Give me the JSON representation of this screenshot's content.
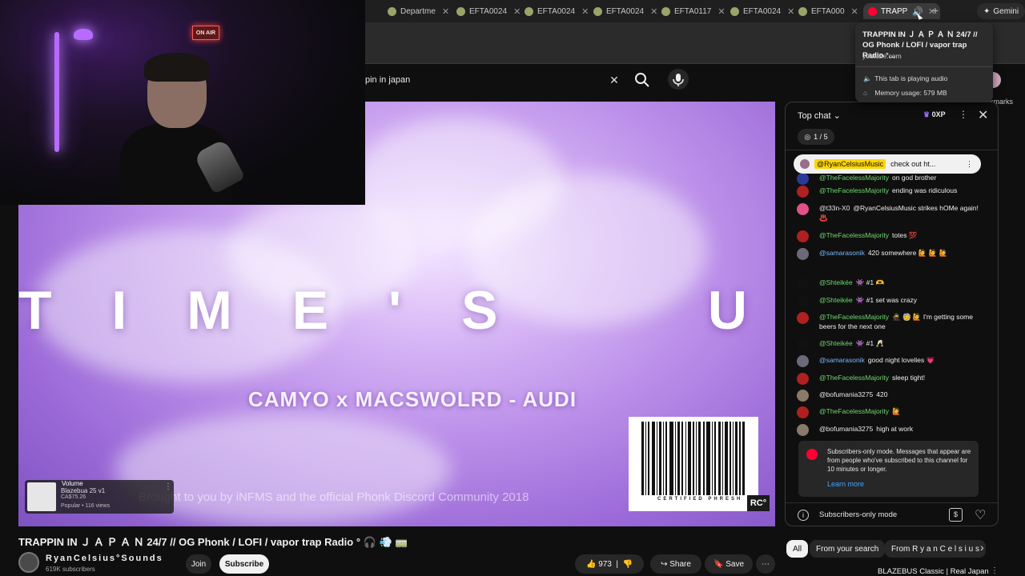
{
  "browser": {
    "tabs": [
      {
        "label": "Departme",
        "color": "#9aa36a"
      },
      {
        "label": "EFTA0024",
        "color": "#9aa36a"
      },
      {
        "label": "EFTA0024",
        "color": "#9aa36a"
      },
      {
        "label": "EFTA0024",
        "color": "#9aa36a"
      },
      {
        "label": "EFTA0117",
        "color": "#9aa36a"
      },
      {
        "label": "EFTA0024",
        "color": "#9aa36a"
      },
      {
        "label": "EFTA000",
        "color": "#9aa36a"
      },
      {
        "label": "TRAPP",
        "color": "#ff0033"
      }
    ],
    "new_tab": "+",
    "gemini_label": "Gemini",
    "addr_right": "able",
    "bookmarks_right": "kmarks"
  },
  "tooltip": {
    "title": "TRAPPIN IN Ｊ Ａ Ｐ Ａ Ｎ 24/7 // OG Phonk / LOFI / vapor trap Radio °...",
    "domain": "youtube.com",
    "audio": "This tab is playing audio",
    "memory": "Memory usage: 579 MB"
  },
  "search": {
    "query": "pin in japan"
  },
  "webcam": {
    "on_air": "ON AIR"
  },
  "video": {
    "headline": "T I M E ' S     U P",
    "song": "CAMYO x MACSWOLRD - AUDI",
    "credit": "Brought to you by iNFMS and the official Phonk Discord Community 2018",
    "barcode_label": "CERTIFIED PHRESH",
    "logo": "RC°",
    "mini_player": {
      "volume": "Volume",
      "title": "Blazebua 25 v1",
      "price": "CA$75.26",
      "meta": "Popular • 116 views"
    }
  },
  "below": {
    "title": "TRAPPIN IN Ｊ Ａ Ｐ Ａ Ｎ 24/7 // OG Phonk / LOFI / vapor trap Radio ° 🎧 💨 🚃",
    "channel": "RyanCelsius°Sounds",
    "subscribers": "619K subscribers",
    "join": "Join",
    "subscribe": "Subscribe",
    "likes": "973",
    "share": "Share",
    "save": "Save"
  },
  "chat": {
    "header": "Top chat",
    "xp": "0XP",
    "goal": "1 / 5",
    "pinned": {
      "user": "@RyanCelsiusMusic",
      "text": "check out ht..."
    },
    "messages": [
      {
        "author": "@TheFacelessMajority",
        "text": "on god brother",
        "style": "green",
        "av": "#2a3a9a"
      },
      {
        "author": "@TheFacelessMajority",
        "text": "ending was ridiculous",
        "style": "green",
        "av": "#b02020"
      },
      {
        "author": "@t33n-X0",
        "text": "@RyanCelsiusMusic strikes hOMe again! ♨️",
        "style": "plain",
        "av": "#e0508a"
      },
      {
        "author": "@TheFacelessMajority",
        "text": "totes 💯",
        "style": "green",
        "av": "#b02020"
      },
      {
        "author": "@samarasonik",
        "text": "420 somewhere 🙋 🙋 🙋",
        "style": "blue",
        "av": "#6a6a7a"
      },
      {
        "author": "@Shteikée",
        "text": "👾 #1 🫶",
        "style": "green",
        "av": "#111111"
      },
      {
        "author": "@Shteikée",
        "text": "👾 #1  set was crazy",
        "style": "green",
        "av": "#111111"
      },
      {
        "author": "@TheFacelessMajority",
        "text": "🥷 🧓 🙋 I'm getting some beers for the next one",
        "style": "green",
        "av": "#b02020"
      },
      {
        "author": "@Shteikée",
        "text": "👾 #1 🥂",
        "style": "green",
        "av": "#111111"
      },
      {
        "author": "@samarasonik",
        "text": "good night lovelies 💗",
        "style": "blue",
        "av": "#6a6a7a"
      },
      {
        "author": "@TheFacelessMajority",
        "text": "sleep tight!",
        "style": "green",
        "av": "#b02020"
      },
      {
        "author": "@bofumania3275",
        "text": "420",
        "style": "plain",
        "av": "#8a7a6a"
      },
      {
        "author": "@TheFacelessMajority",
        "text": "🙋",
        "style": "green",
        "av": "#b02020"
      },
      {
        "author": "@bofumania3275",
        "text": "high at work",
        "style": "plain",
        "av": "#8a7a6a"
      }
    ],
    "notice": "Subscribers-only mode. Messages that appear are from people who've subscribed to this channel for 10 minutes or longer.",
    "learn_more": "Learn more",
    "footer": "Subscribers-only mode"
  },
  "chips": [
    "All",
    "From your search",
    "From R y a n C e l s i u s"
  ],
  "up_next": "BLAZEBUS Classic | Real Japan"
}
